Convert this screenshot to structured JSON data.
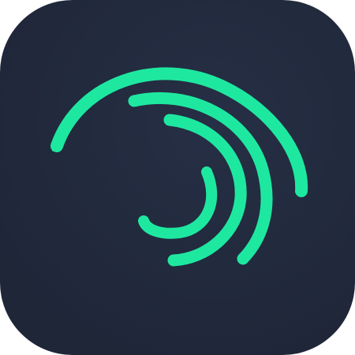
{
  "icon": {
    "name": "swirl-logo-icon",
    "background_color": "#1f2638",
    "background_highlight": "#262f45",
    "stroke_color": "#1ee8a0"
  }
}
